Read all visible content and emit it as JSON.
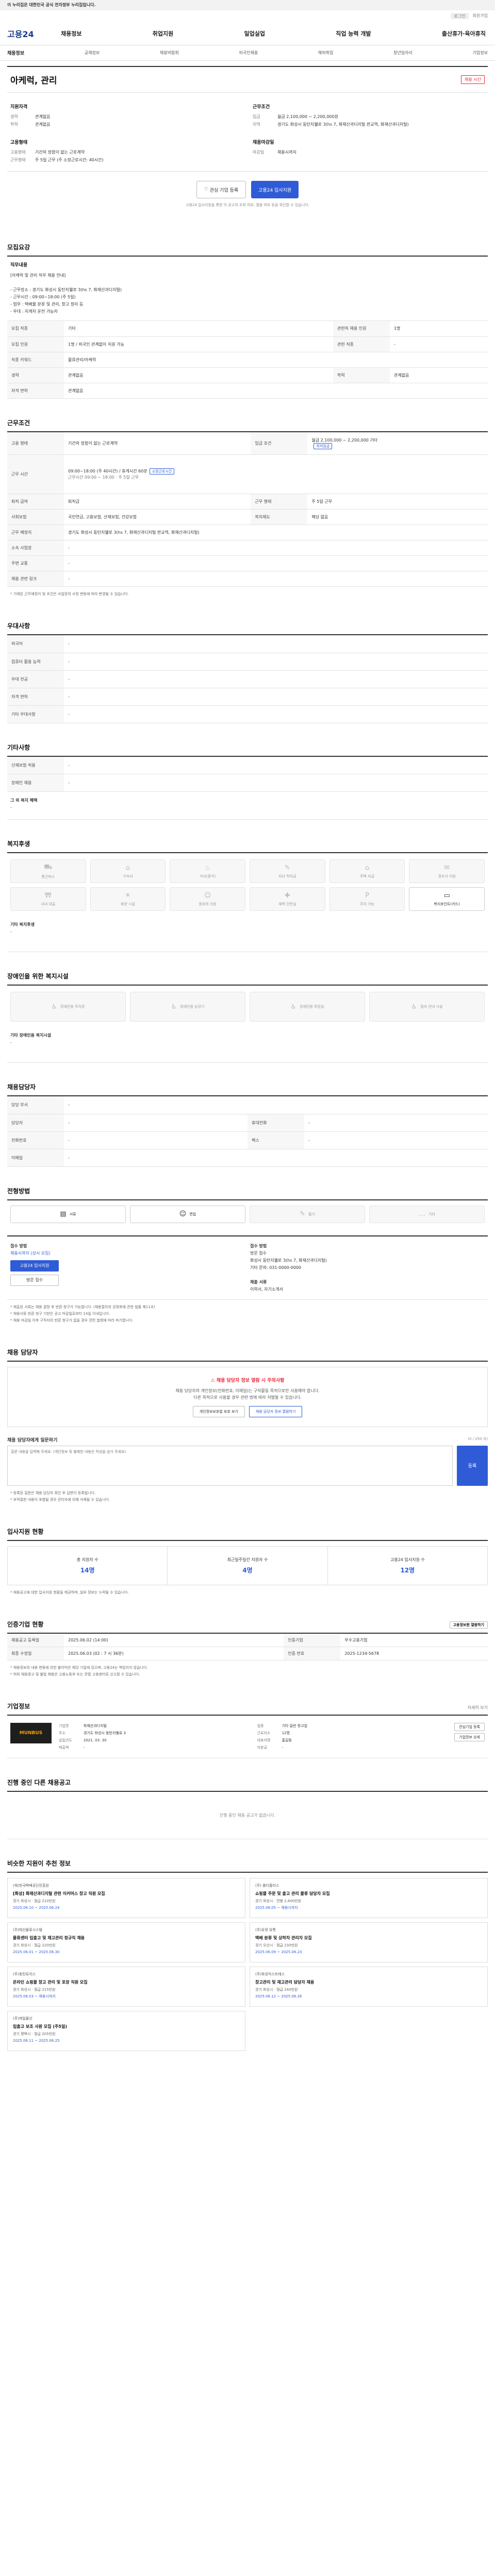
{
  "topbar": {
    "text": "이 누리집은 대한민국 공식 전자정부 누리집입니다."
  },
  "util": {
    "login": "로그인",
    "join": "회원가입"
  },
  "logo": "고용24",
  "gnb": [
    "채용정보",
    "취업지원",
    "일업실업",
    "직업 능력 개발",
    "출산휴가·육아휴직"
  ],
  "subnav": [
    "채용정보",
    "공채정보",
    "채용박람회",
    "외국인채용",
    "해외취업",
    "청년일자리",
    "기업정보"
  ],
  "job": {
    "title": "아케럭, 관리",
    "badge": "채용 시간",
    "req_title": "지원자격",
    "req": [
      {
        "k": "경력",
        "v": "관계없음"
      },
      {
        "k": "학력",
        "v": "관계없음"
      }
    ],
    "cond_title": "근무조건",
    "cond": [
      {
        "k": "임금",
        "v": "월급 2,100,000 ~ 2,200,000원"
      },
      {
        "k": "지역",
        "v": "경기도 화성시 동탄지웰로 3(hs 7, 화재산과디지털 판교역, 화재산과디지털)"
      }
    ],
    "form_title": "고용형태",
    "form": [
      {
        "k": "고용형태",
        "v": "기간의 정함이 없는 근로계약"
      },
      {
        "k": "근무형태",
        "v": "주 5일 근무 (주 소정근로시간: 40시간)"
      }
    ],
    "deadline_title": "채용마감일",
    "deadline": [
      {
        "k": "마감일",
        "v": "채용시까지"
      }
    ],
    "btn_apply": "고용24 입사지원",
    "btn_interest": "관심 기업 등록",
    "note": "고용24 입사지원을 통한 이 공고의 조회 여부, 열람 여부 등을 확인할 수 있습니다."
  },
  "detail": {
    "title": "모집요강",
    "job_content_label": "직무내용",
    "job_content": "[아케럭 및 관리 직무 채용 안내]\n\n- 근무장소 : 경기도 화성시 동탄지웰로 3(hs 7, 화재산과디지털)\n- 근무시간 : 09:00~18:00 (주 5일)\n- 업무 : 택배물 분류 및 관리, 창고 정리 등\n- 우대 : 지게차 운전 가능자",
    "rows": [
      [
        "모집 직종",
        "기타",
        "관련직 채용 인원",
        "1명"
      ],
      [
        "모집 인원",
        "1명 / 외국인 관계없이 지원 가능",
        "관련 직종",
        "-"
      ],
      [
        "직종 키워드",
        "물류관리/아케럭",
        "",
        ""
      ],
      [
        "경력",
        "관계없음",
        "학력",
        "관계없음"
      ],
      [
        "자격 면허",
        "관계없음",
        "",
        ""
      ]
    ]
  },
  "workcond": {
    "title": "근무조건",
    "type_label": "고용 형태",
    "type": "기간의 정함이 없는 근로계약",
    "wage_label": "임금 조건",
    "wage": "월급 2,100,000 ~ 2,200,000 기타",
    "wage_chip": "최저임금",
    "time_label": "근무 시간",
    "time": "09:00~18:00 (주 40시간) / 휴게시간 60분",
    "time_chip": "소정근로시간",
    "time_sub": "근무시간 09:00 ~ 18:00 · 주 5일 근무",
    "rows": [
      [
        "퇴직 급여",
        "퇴직금",
        "근무 형태",
        "주 5일 근무"
      ],
      [
        "사회보험",
        "국민연금, 고용보험, 산재보험, 건강보험",
        "복지제도",
        "해당 없음"
      ],
      [
        "근무 예정지",
        "경기도 화성시 동탄지웰로 3(hs 7, 화재산과디지털 판교역, 화재산과디지털)",
        "",
        ""
      ],
      [
        "소속 사업장",
        "-",
        "",
        ""
      ],
      [
        "주변 교통",
        "-",
        "",
        ""
      ],
      [
        "채용 관련 링크",
        "-",
        "",
        ""
      ]
    ],
    "map_btn": "지도 보기",
    "note": "* 기재된 근무예정지 및 조건은 사업장의 사정 변동에 따라 변경될 수 있습니다."
  },
  "pref": {
    "title": "우대사항",
    "rows": [
      [
        "외국어",
        "-"
      ],
      [
        "컴퓨터 활용 능력",
        "-"
      ],
      [
        "우대 전공",
        "-"
      ],
      [
        "자격 면허",
        "-"
      ],
      [
        "기타 우대사항",
        "-"
      ]
    ]
  },
  "special": {
    "title": "기타사항",
    "rows": [
      [
        "산재보험 적용",
        "-"
      ],
      [
        "장애인 채용",
        "-"
      ]
    ],
    "extra_label": "그 외 복지 혜택",
    "extra": "-"
  },
  "welfare": {
    "title": "복지후생",
    "items": [
      "통근버스",
      "기숙사",
      "식사(중식)",
      "자녀 학자금",
      "주택 자금",
      "경조사 지원",
      "사내 대출",
      "휴양 시설",
      "동호회 지원",
      "체력 단련실",
      "주차 가능",
      "복지포인트(카드)"
    ],
    "active": [
      11
    ],
    "etc_label": "기타 복지후생",
    "etc": "-"
  },
  "disab": {
    "title": "장애인을 위한 복지시설",
    "items": [
      "장애인용 주차장",
      "장애인용 승강기",
      "장애인용 화장실",
      "점자 안내 시설"
    ],
    "etc_label": "기타 장애인용 복지시설",
    "etc": "-"
  },
  "manager": {
    "title": "채용담당자",
    "rows": [
      [
        "담당 부서",
        "-",
        "",
        ""
      ],
      [
        "담당자",
        "-",
        "휴대전화",
        "-"
      ],
      [
        "전화번호",
        "-",
        "팩스",
        "-"
      ],
      [
        "이메일",
        "-",
        "",
        ""
      ]
    ]
  },
  "method": {
    "title": "전형방법",
    "items": [
      "서류",
      "면접",
      "필기",
      "기타"
    ],
    "active": [
      0,
      1
    ]
  },
  "apply": {
    "title_left": "접수 방법",
    "deadline_label": "채용시까지 (상시 모집)",
    "btn_apply": "고용24 입사지원",
    "btn_msg": "방문 접수",
    "title_mid": "접수 방법",
    "mid": "방문 접수\n화성시 동탄지웰로 3(hs 7, 화재산과디지털)\n기타 문의: 031-0000-0000",
    "title_right": "제출 서류",
    "right": "이력서, 자기소개서",
    "notes": [
      "* 제출된 서류는 채용 결정 후 반환 청구가 가능합니다. (채용절차의 공정화에 관한 법률 제11조)",
      "* 채용서류 반환 청구 기한은 공고 마감일로부터 14일 이내입니다.",
      "* 채용 마감일 이후 구직자의 반환 청구가 없을 경우 관련 법령에 따라 파기합니다."
    ]
  },
  "contact": {
    "title": "채용 담당자",
    "alert_title": "채용 담당자 정보 열람 시 주의사항",
    "alert_desc": "채용 담당자의 개인정보(전화번호, 이메일)는 구직활동 목적으로만 사용해야 합니다.\n다른 목적으로 사용할 경우 관련 법에 따라 처벌될 수 있습니다.",
    "btn1": "개인정보보호법 보호 보기",
    "btn2": "채용 담당자 정보 열람하기",
    "q_label": "채용 담당자에게 질문하기",
    "q_note": "(0 / 250 자)",
    "q_placeholder": "질문 내용을 입력해 주세요. (개인정보 및 불쾌한 내용은 작성을 삼가 주세요)",
    "q_send": "등록",
    "q_notes": [
      "* 등록된 질문은 채용 담당자 확인 후 답변이 등록됩니다.",
      "* 부적절한 내용이 포함될 경우 관리자에 의해 삭제될 수 있습니다."
    ]
  },
  "stats": {
    "title": "입사지원 현황",
    "items": [
      {
        "label": "총 지원자 수",
        "value": "14명"
      },
      {
        "label": "최근일주일간 지원자 수",
        "value": "4명"
      },
      {
        "label": "고용24 입사지원 수",
        "value": "12명"
      }
    ],
    "note": "* 채용공고에 대한 입사지원 현황을 제공하며, 일부 정보는 누락될 수 있습니다."
  },
  "history": {
    "title": "인증기업 현황",
    "btn": "고용정보원 열람하기",
    "rows": [
      [
        "채용공고 등록일",
        "2025.06.02 (14:00)",
        "인증기업",
        "우수고용기업"
      ],
      [
        "최종 수정일",
        "2025.06.03 (02 : 7 시 36분)",
        "인증 번호",
        "2025-1234-5678"
      ]
    ],
    "chip": "인증 보기",
    "notes": [
      "* 채용정보의 내용 변동에 의한 불이익은 해당 기업에 있으며, 고용24는 책임지지 않습니다.",
      "* 허위 채용광고 및 불법 채용은 고용노동부 또는 관할 고용센터로 신고할 수 있습니다."
    ]
  },
  "company": {
    "title": "기업정보",
    "more": "자세히 보기",
    "logo_text": "MUNBUS",
    "rows": [
      [
        "기업명",
        "화재산과디지털"
      ],
      [
        "업종",
        "기타 일반 창고업"
      ],
      [
        "주소",
        "경기도 화성시 동탄지웰로 3"
      ],
      [
        "근로자수",
        "12명"
      ],
      [
        "설립년도",
        "2021. 03. 30"
      ],
      [
        "대표자명",
        "홍길동"
      ],
      [
        "매출액",
        "-"
      ],
      [
        "자본금",
        "-"
      ]
    ],
    "btn1": "관심기업 등록",
    "btn2": "기업정보 상세"
  },
  "other": {
    "title": "진행 중인 다른 채용공고",
    "empty": "진행 중인 채용 공고가 없습니다."
  },
  "recommend": {
    "title": "비슷한 지원이 추천 정보",
    "items": [
      {
        "company": "(재)한국택배공단진흥원",
        "title": "[화성] 화재산과디지털 관련 이커머스 창고 직원 모집",
        "meta": "경기 화성시 · 월급 210만원",
        "date": "2025.06.10 ~ 2025.06.24"
      },
      {
        "company": "(주) 롤티플러스",
        "title": "쇼핑몰 주문 및 출고 관리 물류 담당자 모집",
        "meta": "경기 화성시 · 연봉 2,600만원",
        "date": "2025.06.05 ~ 채용시까지"
      },
      {
        "company": "(주)태산물류시스템",
        "title": "물류센터 입출고 및 재고관리 정규직 채용",
        "meta": "경기 화성시 · 월급 220만원",
        "date": "2025.06.01 ~ 2025.06.30"
      },
      {
        "company": "(주)유정 유통",
        "title": "택배 분류 및 상하차 관리자 모집",
        "meta": "경기 오산시 · 월급 230만원",
        "date": "2025.06.09 ~ 2025.06.23"
      },
      {
        "company": "(주)동탄로지스",
        "title": "온라인 쇼핑몰 창고 관리 및 포장 직원 모집",
        "meta": "경기 화성시 · 월급 215만원",
        "date": "2025.06.03 ~ 채용시까지"
      },
      {
        "company": "(주)화성익스프레스",
        "title": "창고관리 및 재고관리 담당자 채용",
        "meta": "경기 화성시 · 월급 240만원",
        "date": "2025.06.12 ~ 2025.06.26"
      },
      {
        "company": "(주)제일물산",
        "title": "입출고 보조 사원 모집 (주5일)",
        "meta": "경기 평택시 · 월급 205만원",
        "date": "2025.06.11 ~ 2025.06.25"
      }
    ]
  },
  "colors": {
    "accent": "#2f5cd6",
    "alert": "#e22233"
  }
}
